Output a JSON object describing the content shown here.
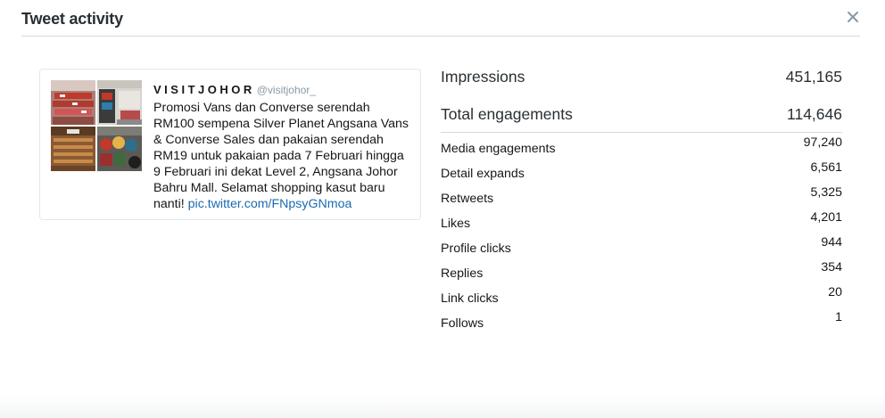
{
  "header": {
    "title": "Tweet activity"
  },
  "tweet": {
    "author_name": "VISITJOHOR",
    "author_handle": "@visitjohor_",
    "text": "Promosi Vans dan Converse serendah RM100 sempena Silver Planet Angsana Vans & Converse Sales dan pakaian serendah RM19 untuk pakaian pada 7 Februari hingga 9 Februari ini dekat Level 2, Angsana Johor Bahru Mall. Selamat shopping kasut baru nanti!",
    "link": "pic.twitter.com/FNpsyGNmoa"
  },
  "stats": {
    "impressions": {
      "label": "Impressions",
      "value": "451,165"
    },
    "total_engagements": {
      "label": "Total engagements",
      "value": "114,646"
    },
    "breakdown": [
      {
        "label": "Media engagements",
        "value": "97,240"
      },
      {
        "label": "Detail expands",
        "value": "6,561"
      },
      {
        "label": "Retweets",
        "value": "5,325"
      },
      {
        "label": "Likes",
        "value": "4,201"
      },
      {
        "label": "Profile clicks",
        "value": "944"
      },
      {
        "label": "Replies",
        "value": "354"
      },
      {
        "label": "Link clicks",
        "value": "20"
      },
      {
        "label": "Follows",
        "value": "1"
      }
    ]
  },
  "icons": {
    "close": "close-icon"
  }
}
